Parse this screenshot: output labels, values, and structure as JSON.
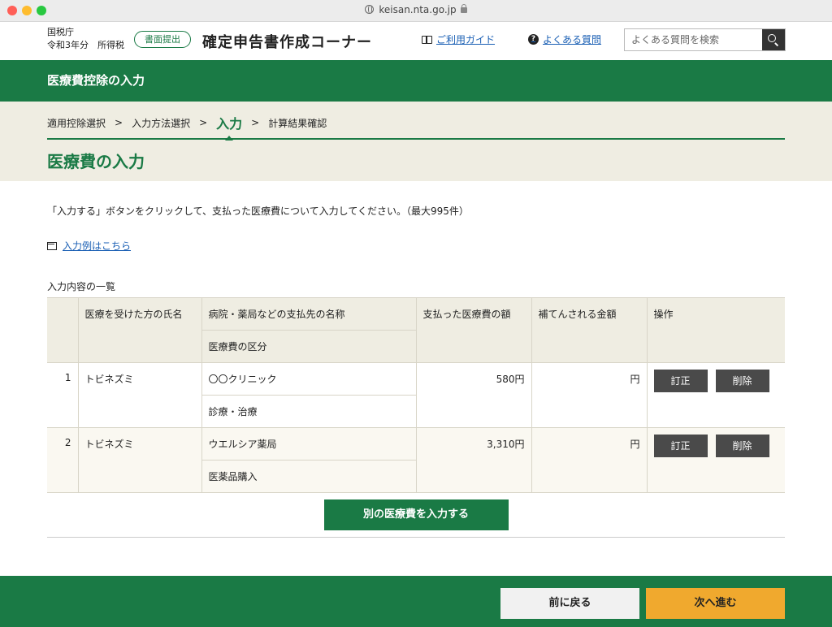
{
  "browser": {
    "url": "keisan.nta.go.jp"
  },
  "header": {
    "agency": "国税庁",
    "year_tax": "令和3年分　所得税",
    "submit_badge": "書面提出",
    "brand": "確定申告書作成コーナー",
    "guide_link": "ご利用ガイド",
    "faq_link": "よくある質問",
    "search_placeholder": "よくある質問を検索"
  },
  "section_bar": {
    "title": "医療費控除の入力"
  },
  "steps": {
    "items": [
      "適用控除選択",
      "入力方法選択",
      "入力",
      "計算結果確認"
    ],
    "separator": ">",
    "current_index": 2
  },
  "page": {
    "title": "医療費の入力",
    "instruction": "「入力する」ボタンをクリックして、支払った医療費について入力してください。（最大995件）",
    "example_link": "入力例はこちら",
    "list_caption": "入力内容の一覧"
  },
  "table": {
    "headers": {
      "name": "医療を受けた方の氏名",
      "payee": "病院・薬局などの支払先の名称",
      "category": "医療費の区分",
      "paid": "支払った医療費の額",
      "reimbursed": "補てんされる金額",
      "ops": "操作"
    },
    "rows": [
      {
        "no": "1",
        "name": "トビネズミ",
        "payee": "〇〇クリニック",
        "category": "診療・治療",
        "paid": "580円",
        "reimbursed": "円",
        "edit": "訂正",
        "delete": "削除"
      },
      {
        "no": "2",
        "name": "トビネズミ",
        "payee": "ウエルシア薬局",
        "category": "医薬品購入",
        "paid": "3,310円",
        "reimbursed": "円",
        "edit": "訂正",
        "delete": "削除"
      }
    ]
  },
  "actions": {
    "add_another": "別の医療費を入力する",
    "back": "前に戻る",
    "next": "次へ進む"
  },
  "colors": {
    "brand_green": "#1a7a45",
    "beige": "#efede2",
    "next_orange": "#f0a92e"
  }
}
